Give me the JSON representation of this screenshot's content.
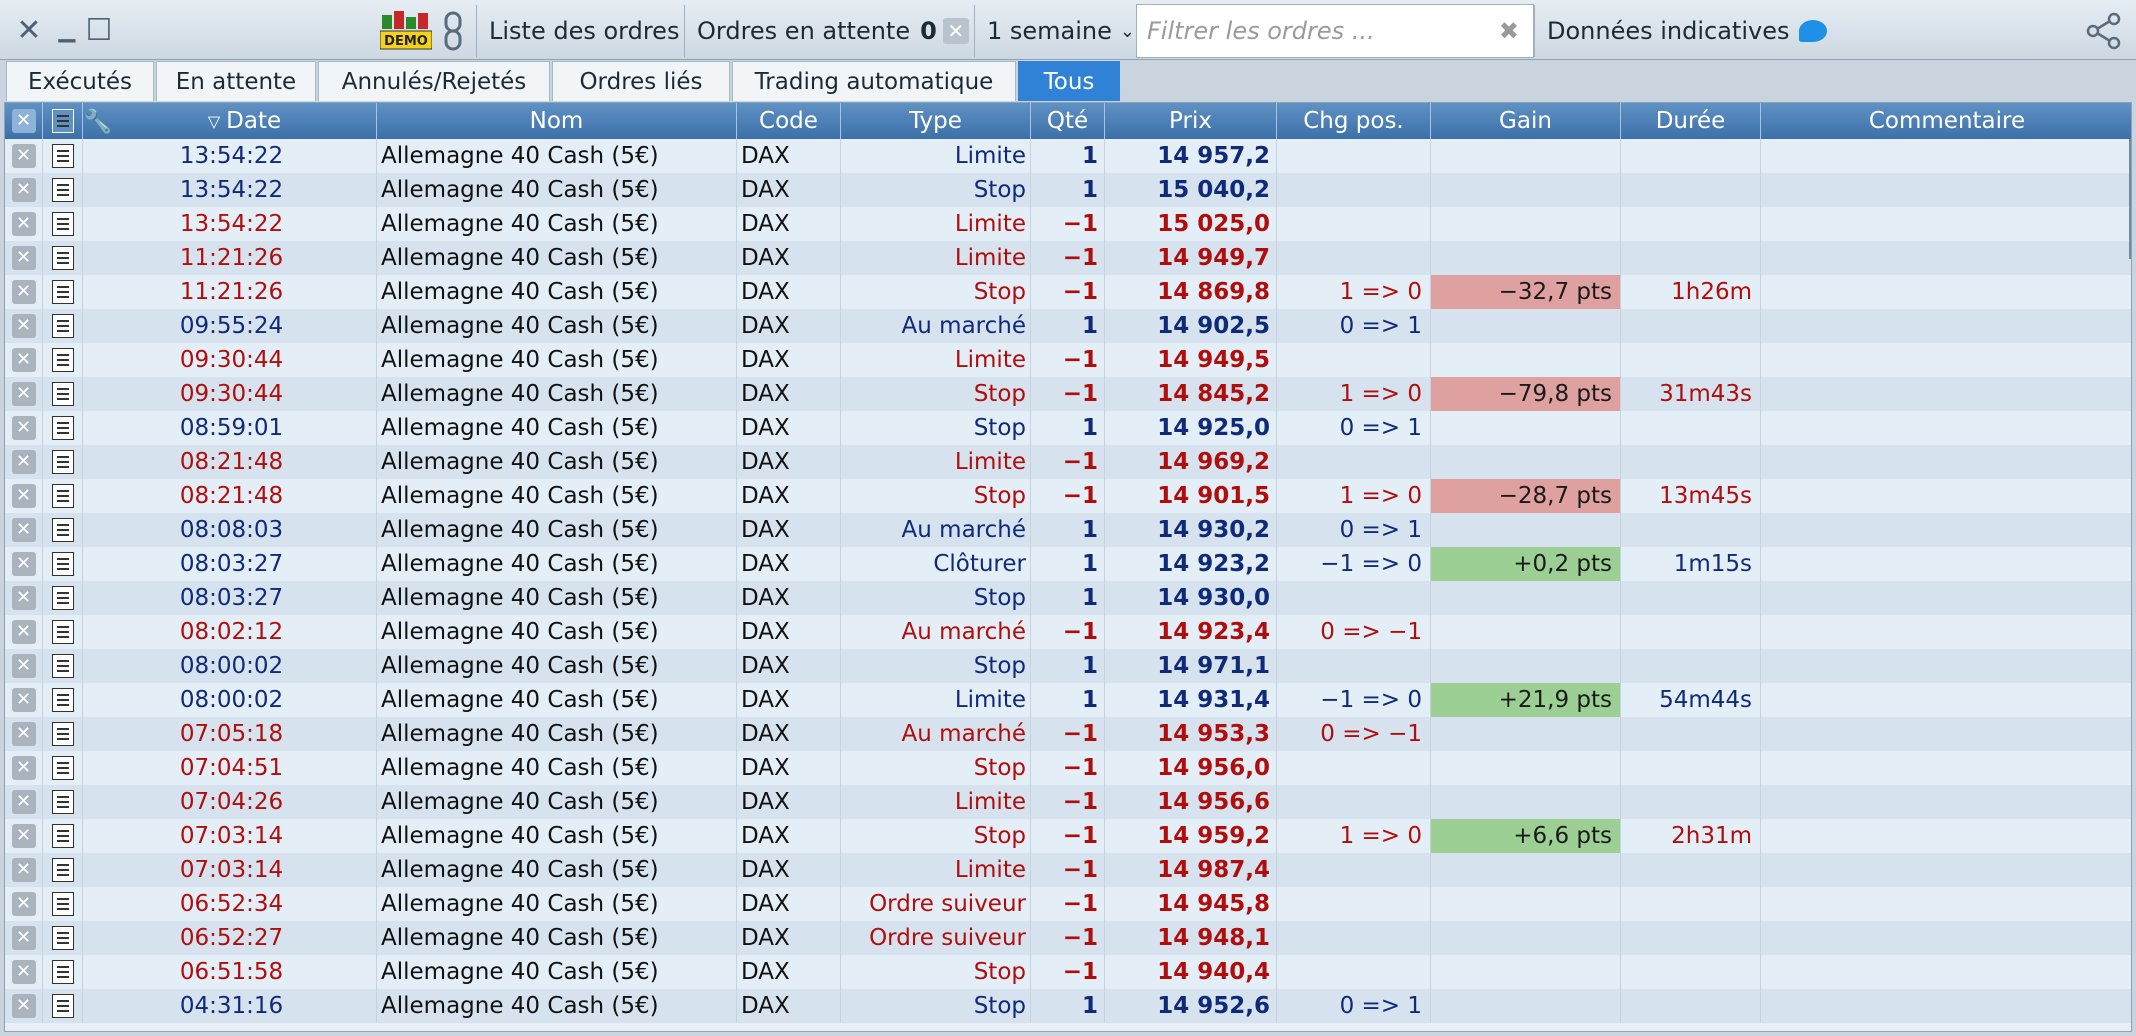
{
  "toolbar": {
    "close_glyph": "✕",
    "minimize_glyph": "▁",
    "maximize_glyph": "☐",
    "demo_label": "DEMO",
    "list_label": "Liste des ordres",
    "pending_label": "Ordres en attente",
    "pending_count": "0",
    "period_label": "1 semaine",
    "filter_placeholder": "Filtrer les ordres ...",
    "indicative_label": "Données indicatives"
  },
  "tabs": [
    {
      "label": "Exécutés",
      "active": false
    },
    {
      "label": "En attente",
      "active": false
    },
    {
      "label": "Annulés/Rejetés",
      "active": false
    },
    {
      "label": "Ordres liés",
      "active": false
    },
    {
      "label": "Trading automatique",
      "active": false
    },
    {
      "label": "Tous",
      "active": true
    }
  ],
  "columns": {
    "date": "Date",
    "nom": "Nom",
    "code": "Code",
    "type": "Type",
    "qte": "Qté",
    "prix": "Prix",
    "chg": "Chg pos.",
    "gain": "Gain",
    "duree": "Durée",
    "commentaire": "Commentaire"
  },
  "colors": {
    "buy": "#0e2a78",
    "sell": "#b00d0d",
    "gain_negative_bg": "#dfa0a0",
    "gain_positive_bg": "#9ccf94",
    "active_tab": "#2f82d6"
  },
  "rows": [
    {
      "date": "13:54:22",
      "nom": "Allemagne 40 Cash (5€)",
      "code": "DAX",
      "type": "Limite",
      "qte": "1",
      "prix": "14 957,2",
      "chg": "",
      "gain": "",
      "duree": "",
      "side": "buy"
    },
    {
      "date": "13:54:22",
      "nom": "Allemagne 40 Cash (5€)",
      "code": "DAX",
      "type": "Stop",
      "qte": "1",
      "prix": "15 040,2",
      "chg": "",
      "gain": "",
      "duree": "",
      "side": "buy"
    },
    {
      "date": "13:54:22",
      "nom": "Allemagne 40 Cash (5€)",
      "code": "DAX",
      "type": "Limite",
      "qte": "−1",
      "prix": "15 025,0",
      "chg": "",
      "gain": "",
      "duree": "",
      "side": "sell"
    },
    {
      "date": "11:21:26",
      "nom": "Allemagne 40 Cash (5€)",
      "code": "DAX",
      "type": "Limite",
      "qte": "−1",
      "prix": "14 949,7",
      "chg": "",
      "gain": "",
      "duree": "",
      "side": "sell"
    },
    {
      "date": "11:21:26",
      "nom": "Allemagne 40 Cash (5€)",
      "code": "DAX",
      "type": "Stop",
      "qte": "−1",
      "prix": "14 869,8",
      "chg": "1 => 0",
      "gain": "−32,7 pts",
      "duree": "1h26m",
      "side": "sell",
      "gain_sign": "neg"
    },
    {
      "date": "09:55:24",
      "nom": "Allemagne 40 Cash (5€)",
      "code": "DAX",
      "type": "Au marché",
      "qte": "1",
      "prix": "14 902,5",
      "chg": "0 => 1",
      "gain": "",
      "duree": "",
      "side": "buy"
    },
    {
      "date": "09:30:44",
      "nom": "Allemagne 40 Cash (5€)",
      "code": "DAX",
      "type": "Limite",
      "qte": "−1",
      "prix": "14 949,5",
      "chg": "",
      "gain": "",
      "duree": "",
      "side": "sell"
    },
    {
      "date": "09:30:44",
      "nom": "Allemagne 40 Cash (5€)",
      "code": "DAX",
      "type": "Stop",
      "qte": "−1",
      "prix": "14 845,2",
      "chg": "1 => 0",
      "gain": "−79,8 pts",
      "duree": "31m43s",
      "side": "sell",
      "gain_sign": "neg"
    },
    {
      "date": "08:59:01",
      "nom": "Allemagne 40 Cash (5€)",
      "code": "DAX",
      "type": "Stop",
      "qte": "1",
      "prix": "14 925,0",
      "chg": "0 => 1",
      "gain": "",
      "duree": "",
      "side": "buy"
    },
    {
      "date": "08:21:48",
      "nom": "Allemagne 40 Cash (5€)",
      "code": "DAX",
      "type": "Limite",
      "qte": "−1",
      "prix": "14 969,2",
      "chg": "",
      "gain": "",
      "duree": "",
      "side": "sell"
    },
    {
      "date": "08:21:48",
      "nom": "Allemagne 40 Cash (5€)",
      "code": "DAX",
      "type": "Stop",
      "qte": "−1",
      "prix": "14 901,5",
      "chg": "1 => 0",
      "gain": "−28,7 pts",
      "duree": "13m45s",
      "side": "sell",
      "gain_sign": "neg"
    },
    {
      "date": "08:08:03",
      "nom": "Allemagne 40 Cash (5€)",
      "code": "DAX",
      "type": "Au marché",
      "qte": "1",
      "prix": "14 930,2",
      "chg": "0 => 1",
      "gain": "",
      "duree": "",
      "side": "buy"
    },
    {
      "date": "08:03:27",
      "nom": "Allemagne 40 Cash (5€)",
      "code": "DAX",
      "type": "Clôturer",
      "qte": "1",
      "prix": "14 923,2",
      "chg": "−1 => 0",
      "gain": "+0,2 pts",
      "duree": "1m15s",
      "side": "buy",
      "gain_sign": "pos"
    },
    {
      "date": "08:03:27",
      "nom": "Allemagne 40 Cash (5€)",
      "code": "DAX",
      "type": "Stop",
      "qte": "1",
      "prix": "14 930,0",
      "chg": "",
      "gain": "",
      "duree": "",
      "side": "buy"
    },
    {
      "date": "08:02:12",
      "nom": "Allemagne 40 Cash (5€)",
      "code": "DAX",
      "type": "Au marché",
      "qte": "−1",
      "prix": "14 923,4",
      "chg": "0 => −1",
      "gain": "",
      "duree": "",
      "side": "sell"
    },
    {
      "date": "08:00:02",
      "nom": "Allemagne 40 Cash (5€)",
      "code": "DAX",
      "type": "Stop",
      "qte": "1",
      "prix": "14 971,1",
      "chg": "",
      "gain": "",
      "duree": "",
      "side": "buy"
    },
    {
      "date": "08:00:02",
      "nom": "Allemagne 40 Cash (5€)",
      "code": "DAX",
      "type": "Limite",
      "qte": "1",
      "prix": "14 931,4",
      "chg": "−1 => 0",
      "gain": "+21,9 pts",
      "duree": "54m44s",
      "side": "buy",
      "gain_sign": "pos"
    },
    {
      "date": "07:05:18",
      "nom": "Allemagne 40 Cash (5€)",
      "code": "DAX",
      "type": "Au marché",
      "qte": "−1",
      "prix": "14 953,3",
      "chg": "0 => −1",
      "gain": "",
      "duree": "",
      "side": "sell"
    },
    {
      "date": "07:04:51",
      "nom": "Allemagne 40 Cash (5€)",
      "code": "DAX",
      "type": "Stop",
      "qte": "−1",
      "prix": "14 956,0",
      "chg": "",
      "gain": "",
      "duree": "",
      "side": "sell"
    },
    {
      "date": "07:04:26",
      "nom": "Allemagne 40 Cash (5€)",
      "code": "DAX",
      "type": "Limite",
      "qte": "−1",
      "prix": "14 956,6",
      "chg": "",
      "gain": "",
      "duree": "",
      "side": "sell"
    },
    {
      "date": "07:03:14",
      "nom": "Allemagne 40 Cash (5€)",
      "code": "DAX",
      "type": "Stop",
      "qte": "−1",
      "prix": "14 959,2",
      "chg": "1 => 0",
      "gain": "+6,6 pts",
      "duree": "2h31m",
      "side": "sell",
      "gain_sign": "pos"
    },
    {
      "date": "07:03:14",
      "nom": "Allemagne 40 Cash (5€)",
      "code": "DAX",
      "type": "Limite",
      "qte": "−1",
      "prix": "14 987,4",
      "chg": "",
      "gain": "",
      "duree": "",
      "side": "sell"
    },
    {
      "date": "06:52:34",
      "nom": "Allemagne 40 Cash (5€)",
      "code": "DAX",
      "type": "Ordre suiveur",
      "qte": "−1",
      "prix": "14 945,8",
      "chg": "",
      "gain": "",
      "duree": "",
      "side": "sell"
    },
    {
      "date": "06:52:27",
      "nom": "Allemagne 40 Cash (5€)",
      "code": "DAX",
      "type": "Ordre suiveur",
      "qte": "−1",
      "prix": "14 948,1",
      "chg": "",
      "gain": "",
      "duree": "",
      "side": "sell"
    },
    {
      "date": "06:51:58",
      "nom": "Allemagne 40 Cash (5€)",
      "code": "DAX",
      "type": "Stop",
      "qte": "−1",
      "prix": "14 940,4",
      "chg": "",
      "gain": "",
      "duree": "",
      "side": "sell"
    },
    {
      "date": "04:31:16",
      "nom": "Allemagne 40 Cash (5€)",
      "code": "DAX",
      "type": "Stop",
      "qte": "1",
      "prix": "14 952,6",
      "chg": "0 => 1",
      "gain": "",
      "duree": "",
      "side": "buy"
    }
  ]
}
